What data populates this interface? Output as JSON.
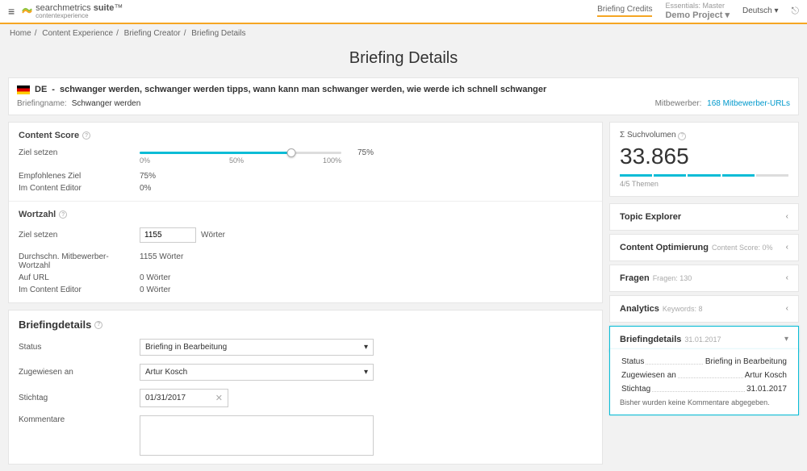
{
  "topbar": {
    "logo_main": "searchmetrics",
    "logo_suite": "suite",
    "logo_sub": "contentexperience",
    "credits": "Briefing Credits",
    "project_super": "Essentials: Master",
    "project_name": "Demo Project",
    "language": "Deutsch"
  },
  "breadcrumb": {
    "items": [
      "Home",
      "Content Experience",
      "Briefing Creator",
      "Briefing Details"
    ]
  },
  "page_title": "Briefing Details",
  "keywords": {
    "country": "DE",
    "list": "schwanger werden, schwanger werden tipps, wann kann man schwanger werden, wie werde ich schnell schwanger",
    "briefingname_label": "Briefingname:",
    "briefingname_value": "Schwanger werden",
    "competitors_label": "Mitbewerber:",
    "competitors_link": "168 Mitbewerber-URLs"
  },
  "content_score": {
    "title": "Content Score",
    "set_goal": "Ziel setzen",
    "ticks": [
      "0%",
      "50%",
      "100%"
    ],
    "current_pct": 75,
    "recommended_label": "Empfohlenes Ziel",
    "recommended_value": "75%",
    "in_editor_label": "Im Content Editor",
    "in_editor_value": "0%"
  },
  "wordcount": {
    "title": "Wortzahl",
    "set_goal": "Ziel setzen",
    "input_value": "1155",
    "unit": "Wörter",
    "avg_label": "Durchschn. Mitbewerber-Wortzahl",
    "avg_value": "1155 Wörter",
    "on_url_label": "Auf URL",
    "on_url_value": "0 Wörter",
    "in_editor_label": "Im Content Editor",
    "in_editor_value": "0 Wörter"
  },
  "briefing_details": {
    "title": "Briefingdetails",
    "status_label": "Status",
    "status_value": "Briefing in Bearbeitung",
    "assigned_label": "Zugewiesen an",
    "assigned_value": "Artur Kosch",
    "deadline_label": "Stichtag",
    "deadline_value": "01/31/2017",
    "comments_label": "Kommentare"
  },
  "right": {
    "sumvol_label": "Σ Suchvolumen",
    "sumvol_value": "33.865",
    "themes": "4/5 Themen",
    "accordions": {
      "topic_explorer": "Topic Explorer",
      "content_opt": "Content Optimierung",
      "content_opt_sub": "Content Score: 0%",
      "fragen": "Fragen",
      "fragen_sub": "Fragen: 130",
      "analytics": "Analytics",
      "analytics_sub": "Keywords: 8",
      "briefing_details": "Briefingdetails",
      "briefing_details_sub": "31.01.2017"
    },
    "details_panel": {
      "status_k": "Status",
      "status_v": "Briefing in Bearbeitung",
      "assigned_k": "Zugewiesen an",
      "assigned_v": "Artur Kosch",
      "deadline_k": "Stichtag",
      "deadline_v": "31.01.2017",
      "no_comments": "Bisher wurden keine Kommentare abgegeben."
    }
  }
}
